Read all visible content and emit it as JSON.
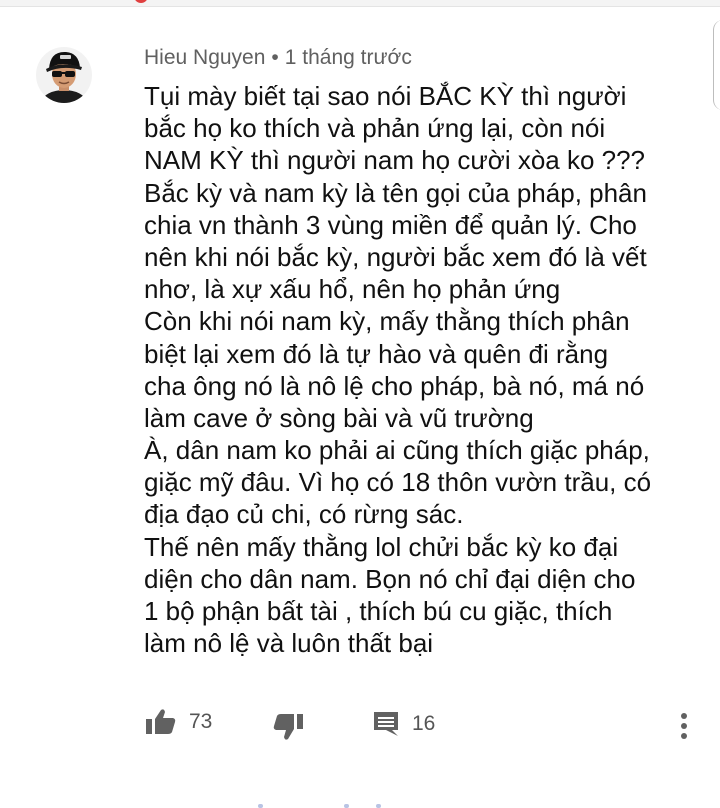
{
  "comment": {
    "author": "Hieu Nguyen",
    "separator": "•",
    "time": "1 tháng trước",
    "lines": [
      "Tụi mày biết tại sao nói BẮC KỲ thì người",
      "bắc họ ko thích và phản ứng lại, còn nói",
      "NAM KỲ thì người nam họ cười xòa ko ???",
      "Bắc kỳ và nam kỳ là tên gọi của pháp, phân",
      "chia vn thành 3 vùng miền để quản lý. Cho",
      "nên khi nói bắc kỳ, người bắc xem đó là vết",
      "nhơ, là xự xấu hổ, nên họ phản ứng",
      "Còn khi nói nam kỳ, mấy thằng thích phân",
      "biệt lại xem đó là tự hào và quên đi rằng",
      "cha ông nó là nô lệ cho pháp, bà nó, má nó",
      "làm cave ở sòng bài và vũ trường",
      "À, dân nam ko phải ai cũng thích giặc pháp,",
      "giặc mỹ đâu. Vì họ có 18 thôn vườn trầu, có",
      "địa đạo củ chi, có rừng sác.",
      "Thế nên mấy thằng lol chửi bắc kỳ ko đại",
      "diện cho dân nam. Bọn nó chỉ đại diện cho",
      "1 bộ phận bất tài , thích bú cu giặc, thích",
      "làm nô lệ và luôn thất bại"
    ]
  },
  "actions": {
    "like_count": "73",
    "reply_count": "16",
    "like_icon": "thumbs-up-icon",
    "dislike_icon": "thumbs-down-icon",
    "reply_icon": "comment-icon",
    "menu_icon": "more-vert-icon"
  },
  "colors": {
    "text": "#111111",
    "meta": "#606060",
    "icon": "#616161",
    "accent_top": "#e04040"
  }
}
